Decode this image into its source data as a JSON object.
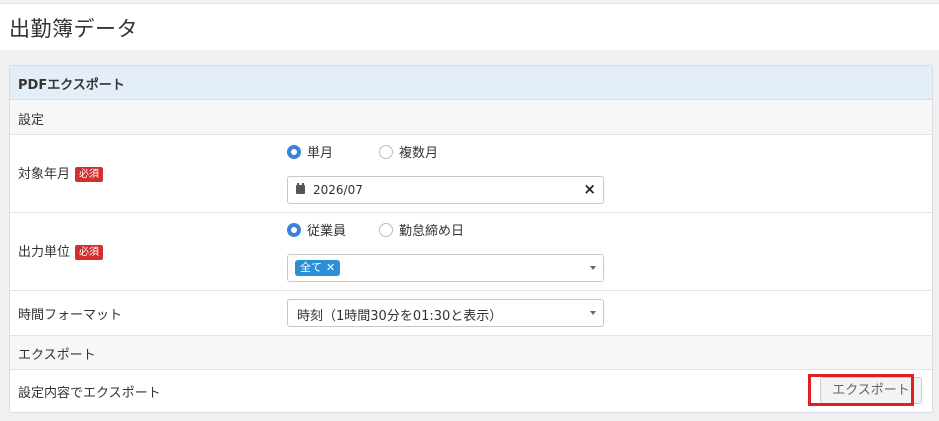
{
  "page": {
    "title": "出勤簿データ"
  },
  "panel": {
    "title": "PDFエクスポート",
    "section_settings": "設定",
    "target_month": {
      "label": "対象年月",
      "required": "必須",
      "options": [
        "単月",
        "複数月"
      ],
      "selected": "単月",
      "date_value": "2026/07",
      "clear_icon": "close-icon",
      "calendar_icon": "calendar-icon"
    },
    "output_unit": {
      "label": "出力単位",
      "required": "必須",
      "options": [
        "従業員",
        "勤怠締め日"
      ],
      "selected": "従業員",
      "tag": "全て",
      "tag_remove": "✕"
    },
    "time_format": {
      "label": "時間フォーマット",
      "value": "時刻（1時間30分を01:30と表示）"
    },
    "section_export": "エクスポート",
    "export_row": {
      "label": "設定内容でエクスポート",
      "button": "エクスポート"
    },
    "colors": {
      "accent": "#3b83d9",
      "badge": "#d32f2f",
      "tag": "#2b8fd6",
      "highlight": "#e02020",
      "head_bg": "#e4eef8"
    }
  }
}
